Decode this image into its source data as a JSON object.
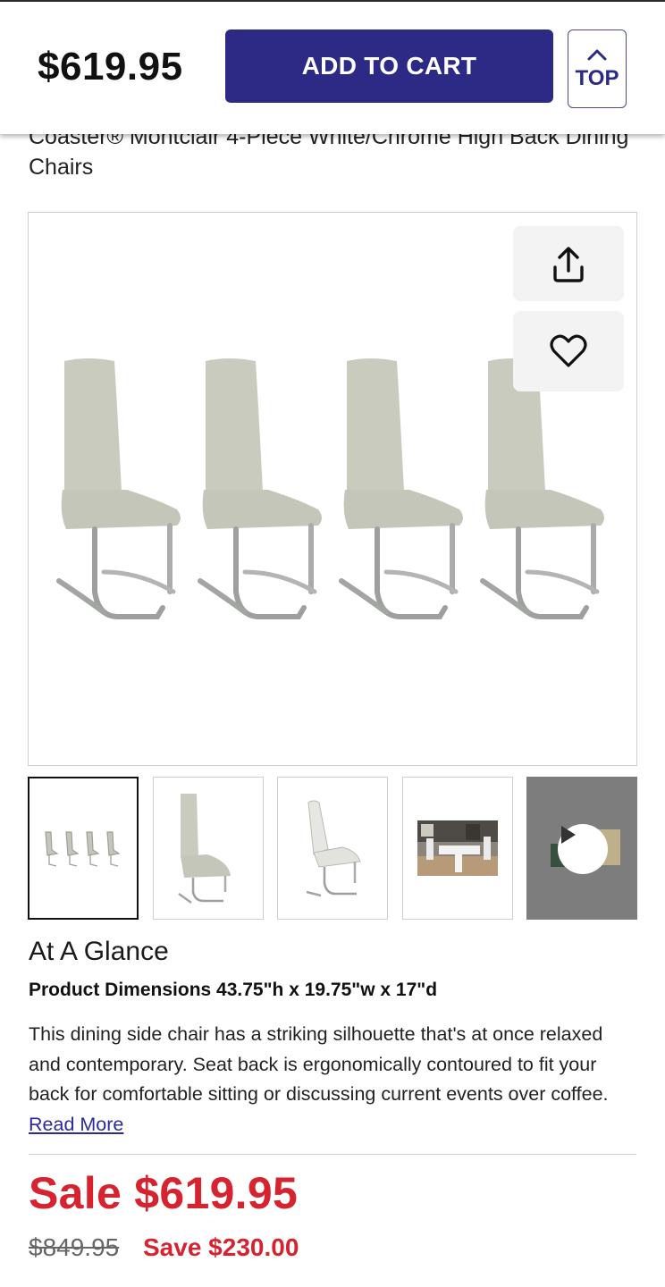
{
  "header": {
    "price": "$619.95",
    "add_to_cart_label": "ADD TO CART",
    "top_label": "TOP"
  },
  "product": {
    "title": "Coaster® Montclair 4-Piece White/Chrome High Back Dining Chairs"
  },
  "gallery": {
    "actions": [
      "share-icon",
      "heart-icon"
    ],
    "thumbnails": [
      "four-chairs",
      "single-chair-gray",
      "single-chair-white",
      "dining-room-scene",
      "video"
    ]
  },
  "glance": {
    "heading": "At A Glance",
    "dimensions": "Product Dimensions 43.75\"h x 19.75\"w x 17\"d",
    "description": "This dining side chair has a striking silhouette that's at once relaxed and contemporary. Seat back is ergonomically contoured to fit your back for comfortable sitting or discussing current events over coffee.",
    "read_more": "Read More"
  },
  "pricing": {
    "sale": "Sale $619.95",
    "original": "$849.95",
    "save": "Save $230.00"
  },
  "colors": {
    "brand": "#2d2a85",
    "sale": "#d6232f"
  }
}
